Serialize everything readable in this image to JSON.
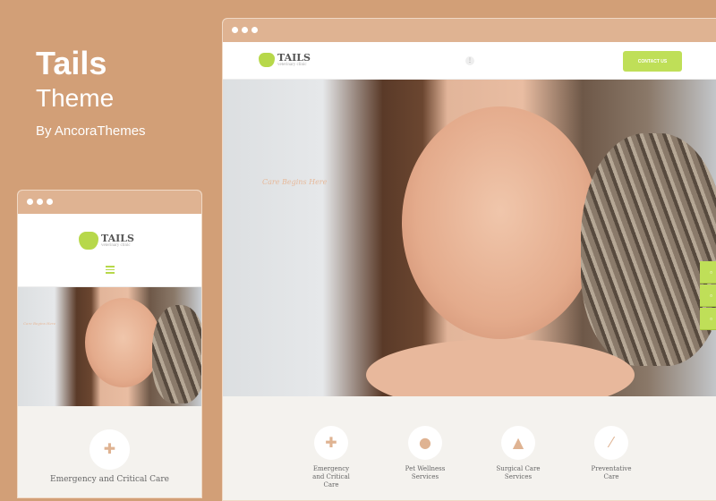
{
  "promo": {
    "title": "Tails",
    "subtitle": "Theme",
    "byline": "By AncoraThemes"
  },
  "site": {
    "logo_name": "TAILS",
    "logo_tagline": "veterinary clinic",
    "contact_label": "CONTACT US",
    "hero_tagline": "Care Begins Here",
    "services": [
      {
        "label": "Emergency and Critical Care",
        "icon": "first-aid-kit-icon"
      },
      {
        "label": "Pet Wellness Services",
        "icon": "paw-icon"
      },
      {
        "label": "Surgical Care Services",
        "icon": "cat-icon"
      },
      {
        "label": "Preventative Care",
        "icon": "syringe-icon"
      }
    ]
  },
  "colors": {
    "background": "#d29f77",
    "accent": "#bfdf58",
    "window_bar": "#dfb392",
    "icon": "#dfb392"
  }
}
